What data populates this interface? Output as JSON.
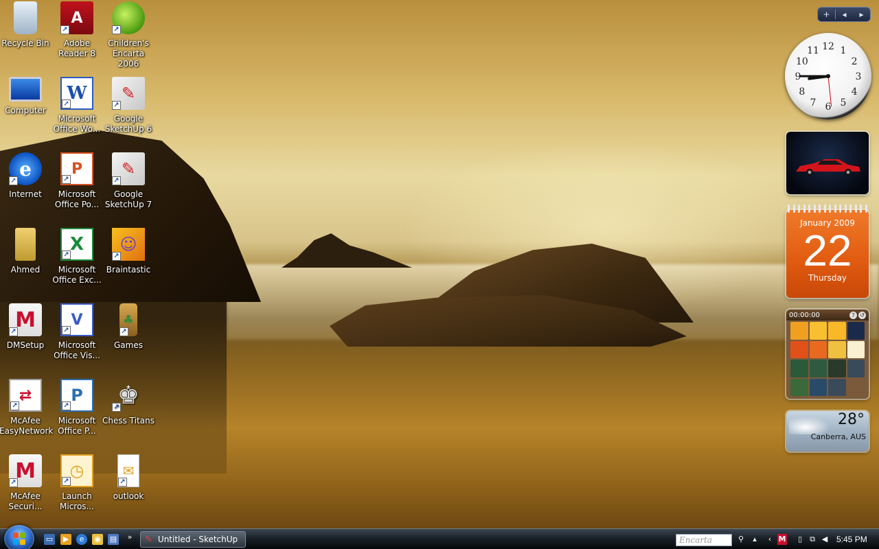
{
  "desktop": {
    "icons": [
      {
        "label": "Recycle Bin",
        "icon": "recycle-bin-icon"
      },
      {
        "label": "Adobe Reader 8",
        "icon": "adobe-reader-icon"
      },
      {
        "label": "Children's Encarta 2006",
        "icon": "encarta-icon"
      },
      {
        "label": "Computer",
        "icon": "computer-icon"
      },
      {
        "label": "Microsoft Office Wo...",
        "icon": "word-icon"
      },
      {
        "label": "Google SketchUp 6",
        "icon": "sketchup-icon"
      },
      {
        "label": "Internet",
        "icon": "internet-explorer-icon"
      },
      {
        "label": "Microsoft Office Po...",
        "icon": "powerpoint-icon"
      },
      {
        "label": "Google SketchUp 7",
        "icon": "sketchup-icon"
      },
      {
        "label": "Ahmed",
        "icon": "folder-icon"
      },
      {
        "label": "Microsoft Office Exc...",
        "icon": "excel-icon"
      },
      {
        "label": "Braintastic",
        "icon": "braintastic-icon"
      },
      {
        "label": "DMSetup",
        "icon": "mcafee-icon"
      },
      {
        "label": "Microsoft Office Vis...",
        "icon": "visio-icon"
      },
      {
        "label": "Games",
        "icon": "games-icon"
      },
      {
        "label": "McAfee EasyNetwork",
        "icon": "easynetwork-icon"
      },
      {
        "label": "Microsoft Office P...",
        "icon": "publisher-icon"
      },
      {
        "label": "Chess Titans",
        "icon": "chess-icon"
      },
      {
        "label": "McAfee Securi...",
        "icon": "mcafee-icon"
      },
      {
        "label": "Launch Micros...",
        "icon": "launch-icon"
      },
      {
        "label": "outlook",
        "icon": "document-icon"
      }
    ]
  },
  "sidebar": {
    "add_label": "+",
    "prev_label": "◂",
    "next_label": "▸",
    "clock": {
      "hour": 8,
      "minute": 45,
      "second": 29
    },
    "calendar": {
      "month": "January 2009",
      "day": "22",
      "weekday": "Thursday"
    },
    "puzzle": {
      "timer": "00:00:00",
      "help_label": "?",
      "close_label": "↺"
    },
    "weather": {
      "temperature": "28°",
      "city": "Canberra, AUS"
    }
  },
  "taskbar": {
    "quicklaunch_more": "»",
    "active_task": "Untitled - SketchUp",
    "encarta_placeholder": "Encarta",
    "time": "5:45 PM"
  },
  "colors": {
    "accent_calendar": "#e05a10",
    "taskbar": "#1b2228"
  }
}
